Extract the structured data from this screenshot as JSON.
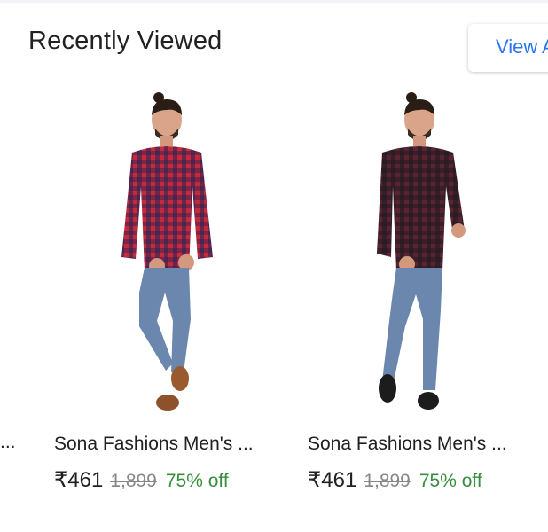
{
  "section": {
    "title": "Recently Viewed",
    "view_all_label": "View All"
  },
  "previous_card": {
    "truncated_name": "..."
  },
  "products": [
    {
      "name": "Sona Fashions Men's ...",
      "price": "₹461",
      "mrp": "1,899",
      "discount": "75% off",
      "image": "man-in-red-check-shirt",
      "shirt_color": "#b8293b",
      "shoe_color": "#9a5a30"
    },
    {
      "name": "Sona Fashions Men's ...",
      "price": "₹461",
      "mrp": "1,899",
      "discount": "75% off",
      "image": "man-in-maroon-check-shirt",
      "shirt_color": "#4a1f2a",
      "shoe_color": "#1c1c1c"
    }
  ],
  "colors": {
    "accent": "#2874f0",
    "discount": "#388e3c",
    "mrp": "#878787",
    "text": "#212121"
  }
}
